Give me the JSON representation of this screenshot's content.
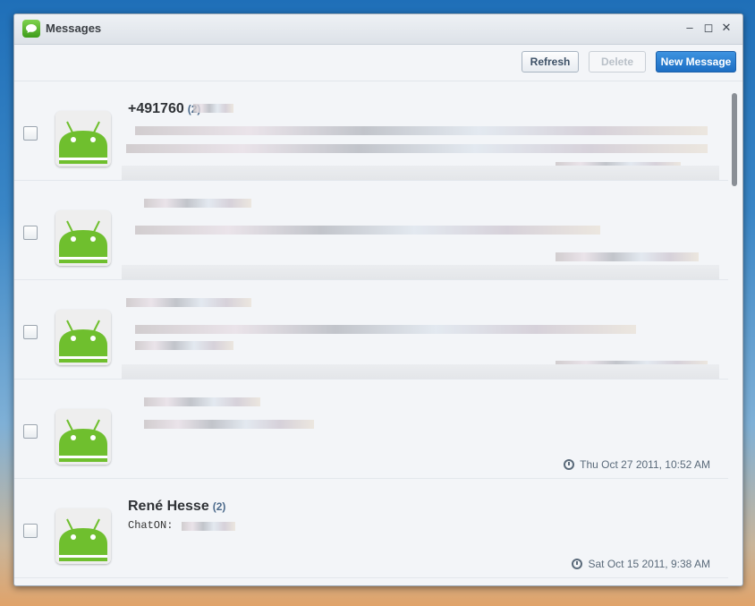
{
  "window": {
    "title": "Messages"
  },
  "toolbar": {
    "refresh": "Refresh",
    "delete": "Delete",
    "new_message": "New Message"
  },
  "messages": [
    {
      "sender": "+491760",
      "count": "(2)",
      "preview": "",
      "timestamp": ""
    },
    {
      "sender": "",
      "count": "",
      "preview": "",
      "timestamp": ""
    },
    {
      "sender": "",
      "count": "",
      "preview": "",
      "timestamp": ""
    },
    {
      "sender": "",
      "count": "",
      "preview": "",
      "timestamp": "Thu Oct 27 2011, 10:52 AM"
    },
    {
      "sender": "René Hesse",
      "count": "(2)",
      "preview": "ChatON:",
      "timestamp": "Sat Oct 15 2011, 9:38 AM"
    }
  ]
}
